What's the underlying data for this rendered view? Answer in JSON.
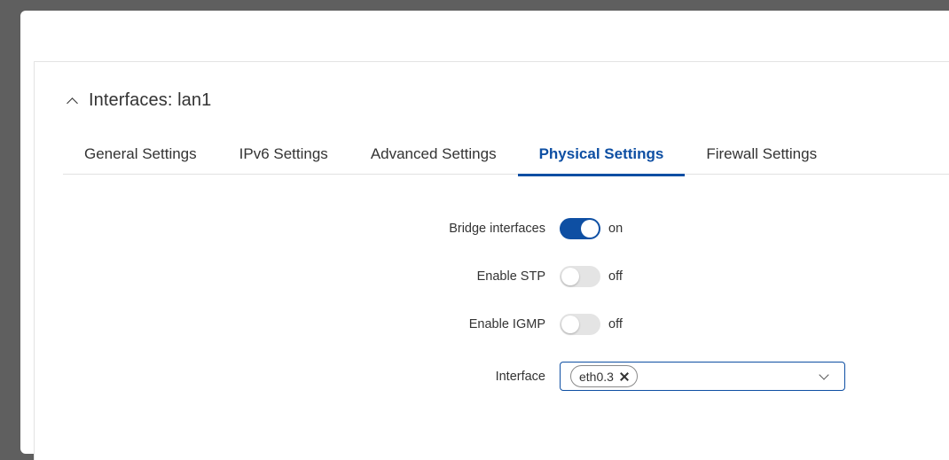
{
  "section": {
    "title": "Interfaces: lan1",
    "collapse_icon": "chevron-up-icon"
  },
  "tabs": [
    {
      "label": "General Settings",
      "active": false
    },
    {
      "label": "IPv6 Settings",
      "active": false
    },
    {
      "label": "Advanced Settings",
      "active": false
    },
    {
      "label": "Physical Settings",
      "active": true
    },
    {
      "label": "Firewall Settings",
      "active": false
    }
  ],
  "form": {
    "bridge_interfaces": {
      "label": "Bridge interfaces",
      "state": "on"
    },
    "enable_stp": {
      "label": "Enable STP",
      "state": "off"
    },
    "enable_igmp": {
      "label": "Enable IGMP",
      "state": "off"
    },
    "interface": {
      "label": "Interface",
      "selected": [
        "eth0.3"
      ],
      "remove_icon": "close-icon",
      "dropdown_icon": "chevron-down-icon"
    }
  },
  "colors": {
    "accent": "#0e4fa3",
    "backdrop": "#5f5f5f",
    "toggle_off": "#e4e4e4"
  }
}
